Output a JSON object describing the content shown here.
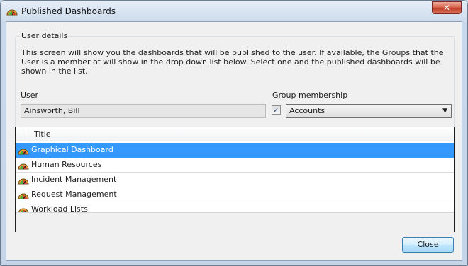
{
  "window": {
    "title": "Published Dashboards",
    "close_glyph": "✕",
    "icon": "gauge-icon"
  },
  "user_details": {
    "legend": "User details",
    "description": "This screen will show you the dashboards that will be published to the user. If available, the Groups that the User is a member of will show in the drop down list below. Select one and the published dashboards will be shown in the list.",
    "user_label": "User",
    "user_value": "Ainsworth, Bill",
    "group_label": "Group membership",
    "group_checked": true,
    "group_value": "Accounts"
  },
  "list": {
    "column_title": "Title",
    "items": [
      {
        "label": "Graphical Dashboard",
        "selected": true,
        "icon": "gauge-icon"
      },
      {
        "label": "Human Resources",
        "selected": false,
        "icon": "gauge-icon"
      },
      {
        "label": "Incident Management",
        "selected": false,
        "icon": "gauge-icon"
      },
      {
        "label": "Request Management",
        "selected": false,
        "icon": "gauge-icon"
      },
      {
        "label": "Workload Lists",
        "selected": false,
        "icon": "gauge-icon"
      }
    ]
  },
  "footer": {
    "close_label": "Close"
  },
  "colors": {
    "selection": "#3399ff",
    "titlebar_close": "#c9503a"
  }
}
